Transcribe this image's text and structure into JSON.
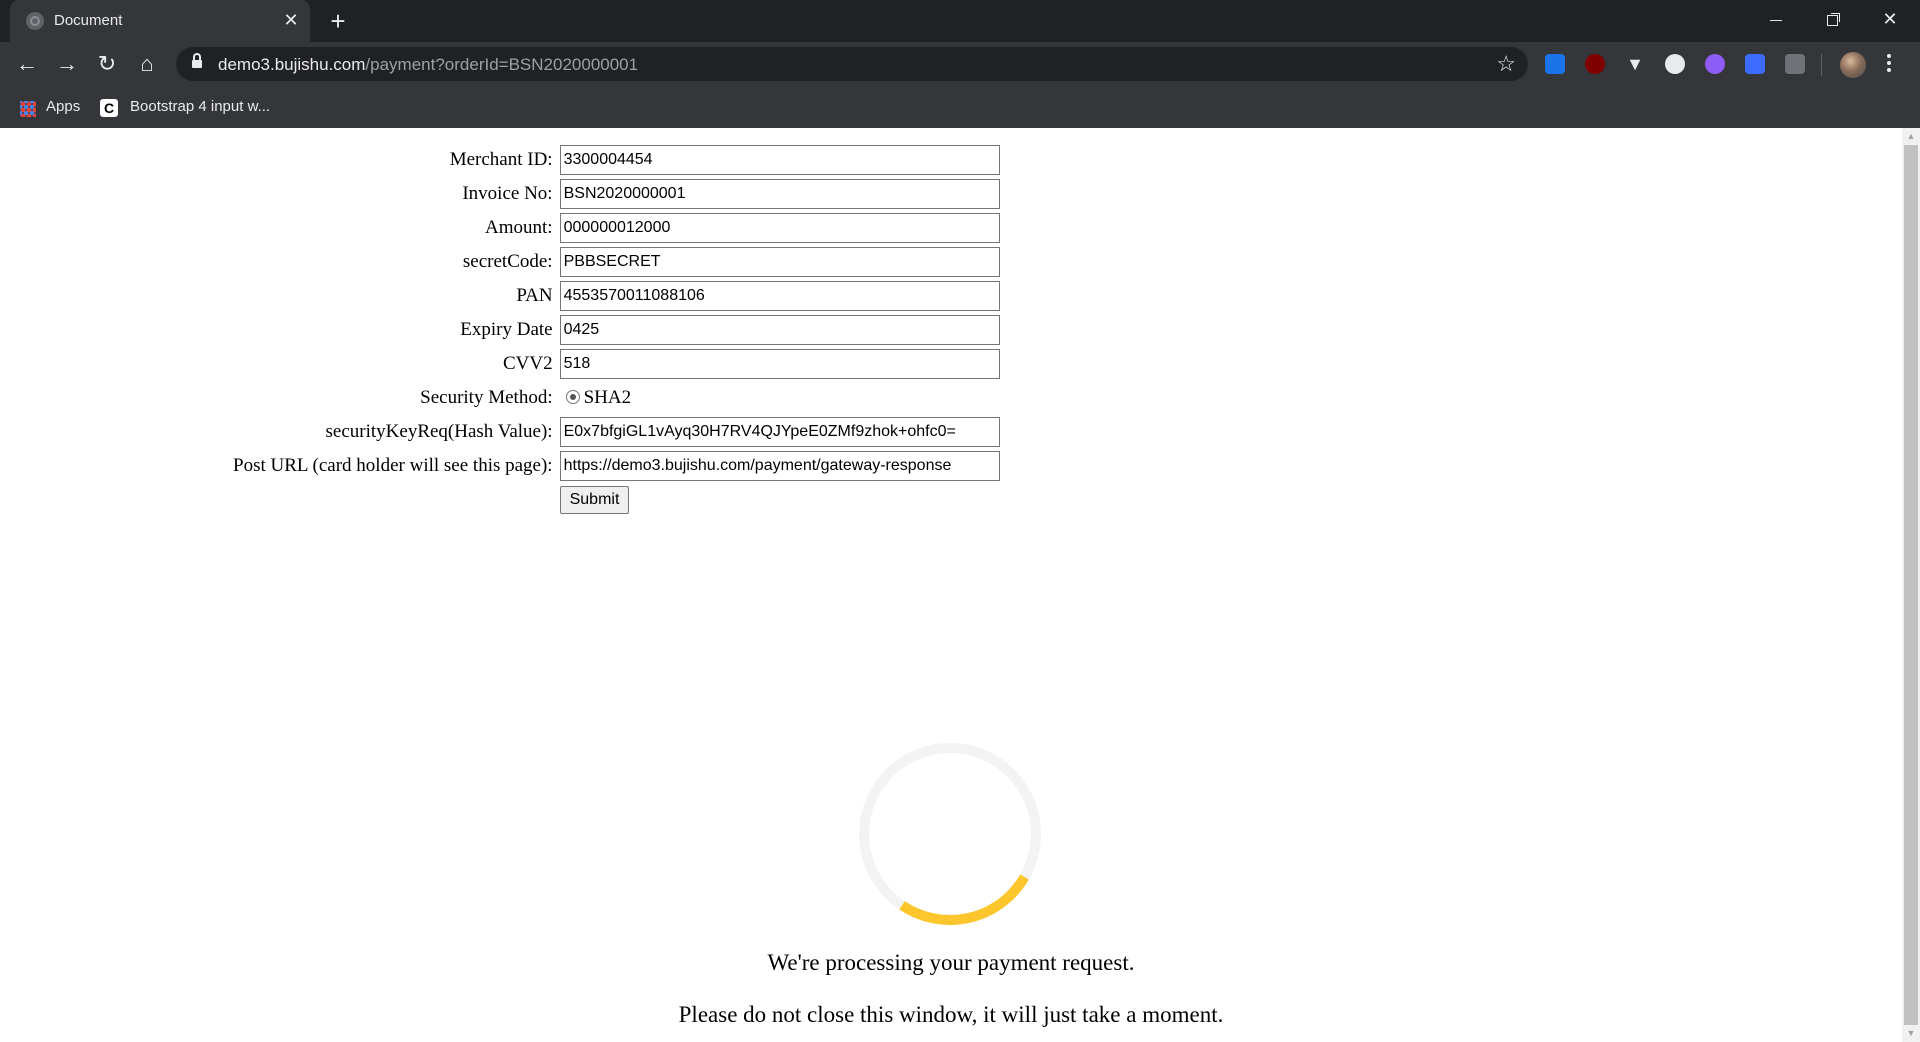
{
  "browser": {
    "tab_title": "Document",
    "url_host": "demo3.bujishu.com",
    "url_path": "/payment?orderId=BSN2020000001",
    "bookmarks": [
      {
        "label": "Apps"
      },
      {
        "label": "Bootstrap 4 input w..."
      }
    ]
  },
  "form": {
    "fields": [
      {
        "label": "Merchant ID:",
        "value": "3300004454"
      },
      {
        "label": "Invoice No:",
        "value": "BSN2020000001"
      },
      {
        "label": "Amount:",
        "value": "000000012000"
      },
      {
        "label": "secretCode:",
        "value": "PBBSECRET"
      },
      {
        "label": "PAN",
        "value": "4553570011088106"
      },
      {
        "label": "Expiry Date",
        "value": "0425"
      },
      {
        "label": "CVV2",
        "value": "518"
      }
    ],
    "security_method_label": "Security Method:",
    "security_method_option": "SHA2",
    "hash_label": "securityKeyReq(Hash Value):",
    "hash_value": "E0x7bfgiGL1vAyq30H7RV4QJYpeE0ZMf9zhok+ohfc0=",
    "post_url_label": "Post URL (card holder will see this page):",
    "post_url_value": "https://demo3.bujishu.com/payment/gateway-response",
    "submit_label": "Submit"
  },
  "processing": {
    "line1": "We're processing your payment request.",
    "line2": "Please do not close this window, it will just take a moment.",
    "spinner_track_color": "#f3f3f3",
    "spinner_color": "#fcc62c"
  }
}
